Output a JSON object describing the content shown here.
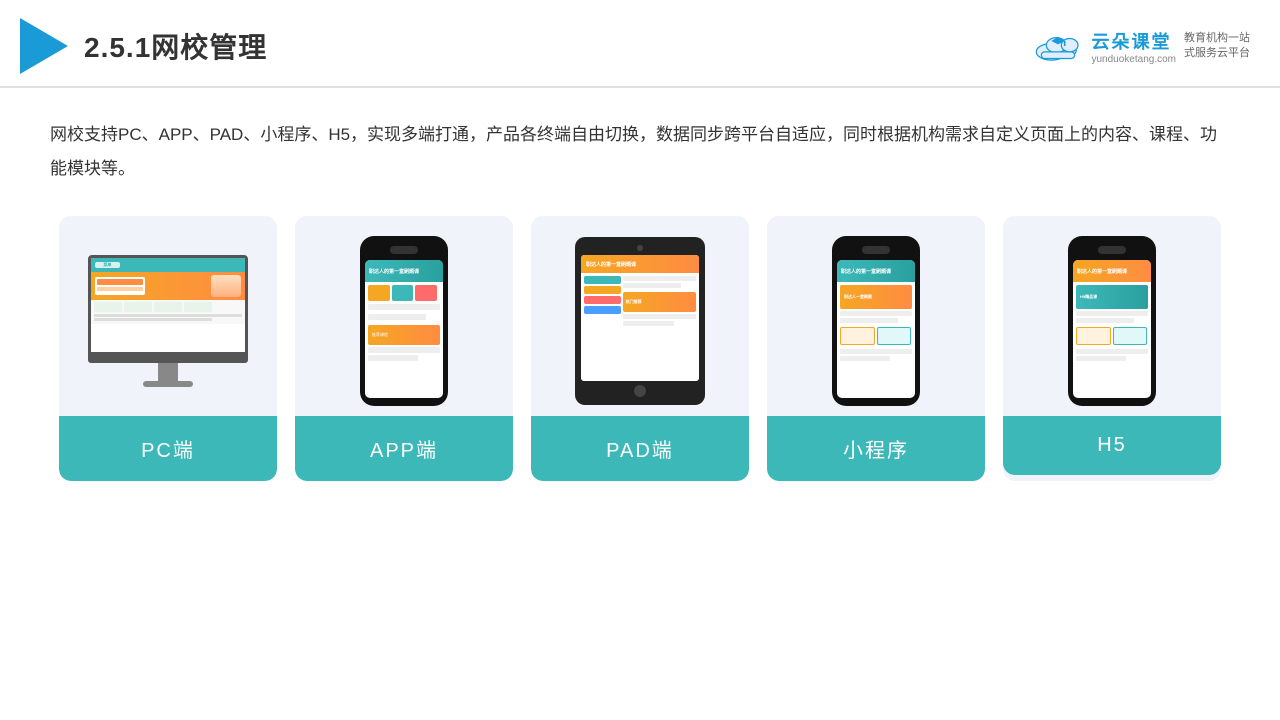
{
  "header": {
    "title": "2.5.1网校管理",
    "brand_name": "云朵课堂",
    "brand_url": "yunduoketang.com",
    "brand_tagline_line1": "教育机构一站",
    "brand_tagline_line2": "式服务云平台"
  },
  "description": "网校支持PC、APP、PAD、小程序、H5，实现多端打通，产品各终端自由切换，数据同步跨平台自适应，同时根据机构需求自定义页面上的内容、课程、功能模块等。",
  "cards": [
    {
      "id": "pc",
      "label": "PC端"
    },
    {
      "id": "app",
      "label": "APP端"
    },
    {
      "id": "pad",
      "label": "PAD端"
    },
    {
      "id": "miniprogram",
      "label": "小程序"
    },
    {
      "id": "h5",
      "label": "H5"
    }
  ]
}
